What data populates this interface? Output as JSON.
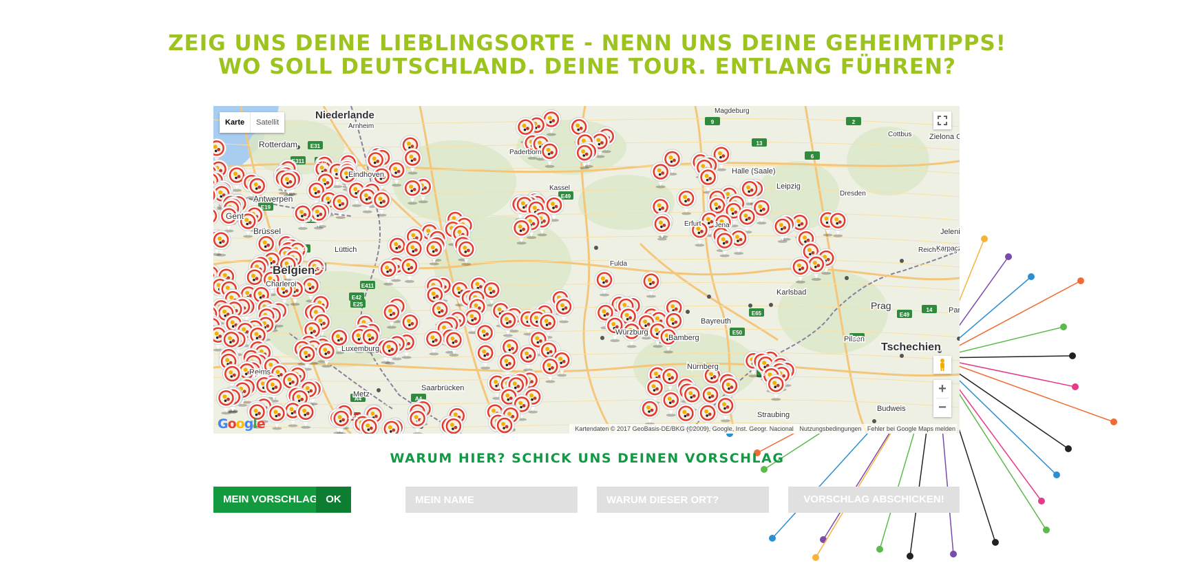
{
  "headline": {
    "line1": "ZEIG UNS DEINE LIEBLINGSORTE - NENN UNS DEINE GEHEIMTIPPS!",
    "line2": "WO SOLL DEUTSCHLAND. DEINE TOUR. ENTLANG FÜHREN?"
  },
  "map": {
    "type_control": {
      "map_label": "Karte",
      "satellite_label": "Satellit"
    },
    "zoom_in_label": "+",
    "zoom_out_label": "−",
    "fullscreen_icon": "fullscreen-icon",
    "pegman_icon": "pegman-icon",
    "logo_text": "Google",
    "attribution": "Kartendaten © 2017 GeoBasis-DE/BKG (©2009), Google, Inst. Geogr. Nacional",
    "terms_link": "Nutzungsbedingungen",
    "report_link": "Fehler bei Google Maps melden",
    "place_labels": [
      "Niederlande",
      "Arnheim",
      "Rotterdam",
      "Eindhoven",
      "Antwerpen",
      "Gent",
      "Brüssel",
      "Lüttich",
      "Belgien",
      "Charleroi",
      "Luxemburg",
      "Reims",
      "Metz",
      "Saarbrücken",
      "Paderborn",
      "Kassel",
      "Fulda",
      "Würzburg",
      "Bamberg",
      "Bayreuth",
      "Nürnberg",
      "Erfurt",
      "Jena",
      "Halle (Saale)",
      "Leipzig",
      "Magdeburg",
      "Dresden",
      "Cottbus",
      "Zielona Góra",
      "Jelenia G",
      "Reichenberg",
      "Karpacz",
      "Karlsbad",
      "Prag",
      "Pardu",
      "Pilsen",
      "Tschechien",
      "Budweis",
      "Straubing"
    ],
    "road_labels": [
      "E31",
      "E311",
      "E25",
      "E19",
      "E313",
      "E40",
      "E42",
      "E411",
      "E42",
      "E25",
      "A26",
      "A4",
      "A4",
      "A31",
      "A4",
      "E49",
      "E50",
      "E65",
      "E67",
      "E49",
      "14",
      "9",
      "13",
      "2",
      "9",
      "6",
      "7"
    ],
    "marker_icon": "map-pin-icon",
    "marker_count_visible": 300
  },
  "subheadline": "WARUM HIER? SCHICK UNS DEINEN VORSCHLAG",
  "form": {
    "mein_vorschlag_label": "MEIN VORSCHLAG",
    "ok_label": "OK",
    "name_placeholder": "MEIN NAME",
    "reason_placeholder": "WARUM DIESER ORT?",
    "submit_label": "VORSCHLAG ABSCHICKEN!"
  },
  "colors": {
    "headline_lime": "#9cc31e",
    "subheadline_green": "#119a43",
    "button_green": "#139a3f",
    "ok_green": "#0d7d32",
    "input_grey": "#e0e0e0"
  }
}
